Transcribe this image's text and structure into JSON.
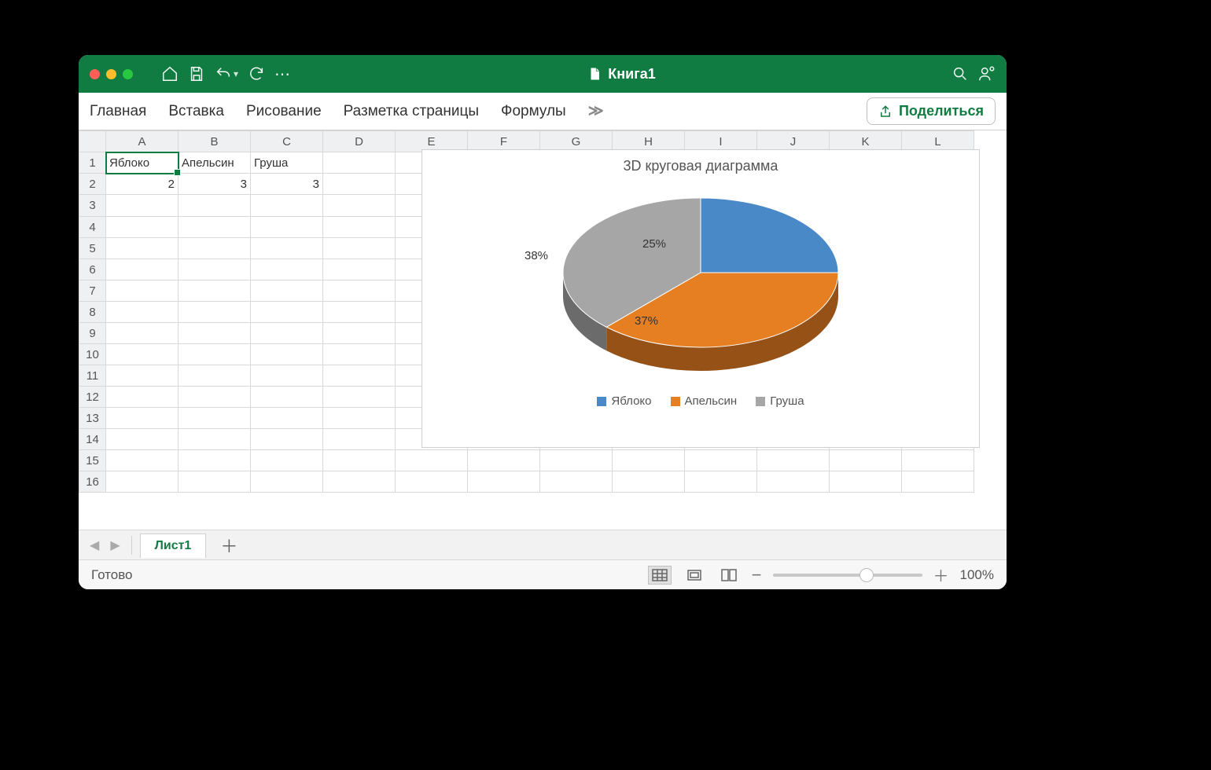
{
  "window": {
    "title": "Книга1"
  },
  "ribbon": {
    "tabs": [
      "Главная",
      "Вставка",
      "Рисование",
      "Разметка страницы",
      "Формулы"
    ],
    "more": "≫",
    "share": "Поделиться"
  },
  "columns": [
    "A",
    "B",
    "C",
    "D",
    "E",
    "F",
    "G",
    "H",
    "I",
    "J",
    "K",
    "L"
  ],
  "rows": [
    "1",
    "2",
    "3",
    "4",
    "5",
    "6",
    "7",
    "8",
    "9",
    "10",
    "11",
    "12",
    "13",
    "14",
    "15",
    "16"
  ],
  "cells": {
    "A1": "Яблоко",
    "B1": "Апельсин",
    "C1": "Груша",
    "A2": "2",
    "B2": "3",
    "C2": "3"
  },
  "selected_cell": "A1",
  "sheet_tab": "Лист1",
  "status": {
    "ready": "Готово",
    "zoom": "100%"
  },
  "chart_data": {
    "type": "pie",
    "title": "3D круговая диаграмма",
    "series": [
      {
        "name": "Яблоко",
        "value": 2,
        "pct": 25,
        "label": "25%",
        "color": "#4A89C8"
      },
      {
        "name": "Апельсин",
        "value": 3,
        "pct": 37,
        "label": "37%",
        "color": "#E67E22"
      },
      {
        "name": "Груша",
        "value": 3,
        "pct": 38,
        "label": "38%",
        "color": "#A6A6A6"
      }
    ],
    "legend_position": "bottom"
  }
}
